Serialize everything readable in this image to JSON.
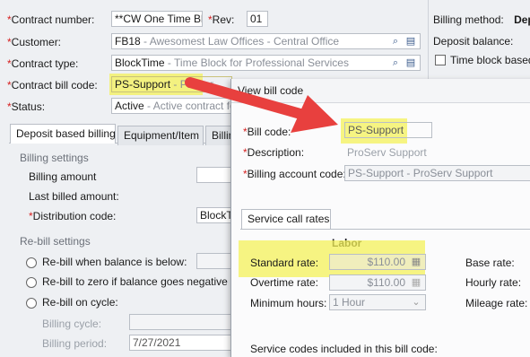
{
  "header": {
    "contract_number": {
      "label": "Contract number:",
      "value": "**CW One Time Bloc"
    },
    "rev": {
      "label": "Rev:",
      "value": "01"
    },
    "customer": {
      "label": "Customer:",
      "code": "FB18",
      "desc": " - Awesomest Law Offices - Central Office"
    },
    "contract_type": {
      "label": "Contract type:",
      "code": "BlockTime",
      "desc": " - Time Block for Professional Services"
    },
    "bill_code": {
      "label": "Contract bill code:",
      "code": "PS-Support",
      "desc": " - ProSer"
    },
    "status": {
      "label": "Status:",
      "code": "Active",
      "desc": " - Active contract fo"
    }
  },
  "right_panel": {
    "billing_method_label": "Billing method:",
    "billing_method_value": "Dep",
    "deposit_balance_label": "Deposit balance:",
    "time_block_label": "Time block based"
  },
  "tabs": [
    "Deposit based billing",
    "Equipment/Item",
    "Billin"
  ],
  "billing_settings": {
    "title": "Billing settings",
    "billing_amount": "Billing amount",
    "last_billed": "Last billed amount:",
    "distribution_code_label": "Distribution code:",
    "distribution_code_value": "BlockTim"
  },
  "rebill": {
    "title": "Re-bill settings",
    "opt1": "Re-bill when balance is below:",
    "opt2": "Re-bill to zero if balance goes negative",
    "opt3": "Re-bill on cycle:",
    "cycle_label": "Billing cycle:",
    "period_label": "Billing period:",
    "period_value": "7/27/2021"
  },
  "dialog": {
    "title": "View bill code",
    "bill_code_label": "Bill code:",
    "bill_code_value": "PS-Support",
    "description_label": "Description:",
    "description_value": "ProServ Support",
    "billing_account_label": "Billing account code:",
    "billing_account_value": "PS-Support - ProServ Support",
    "tab": "Service call rates",
    "labor_title": "Labor",
    "standard_rate_label": "Standard rate:",
    "standard_rate_value": "$110.00",
    "overtime_rate_label": "Overtime rate:",
    "overtime_rate_value": "$110.00",
    "min_hours_label": "Minimum hours:",
    "min_hours_value": "1 Hour",
    "base_rate_label": "Base rate:",
    "hourly_rate_label": "Hourly rate:",
    "mileage_rate_label": "Mileage rate:",
    "service_codes_label": "Service codes included in this bill code:"
  },
  "colors": {
    "highlight": "#f4f25a",
    "arrow": "#e8403e",
    "required": "#d61f1f"
  }
}
